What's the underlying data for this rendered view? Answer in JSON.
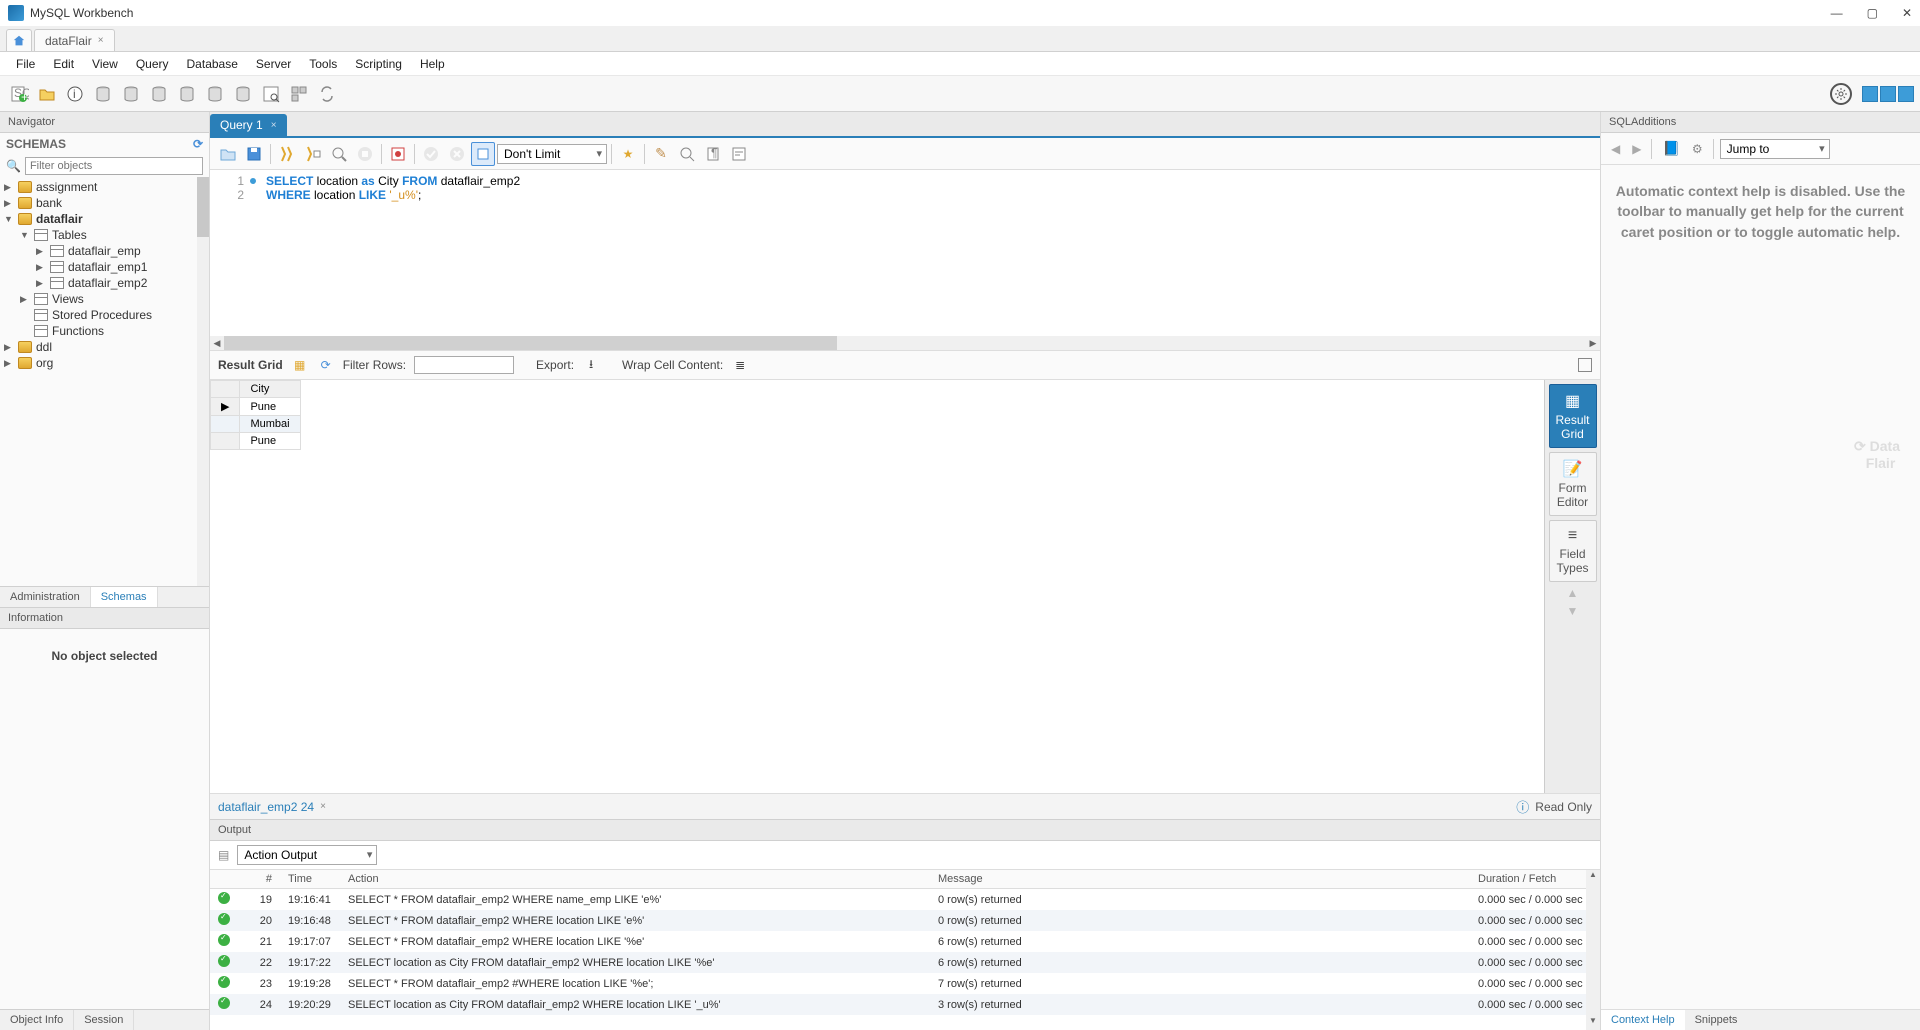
{
  "app": {
    "title": "MySQL Workbench"
  },
  "connTab": {
    "name": "dataFlair"
  },
  "menu": [
    "File",
    "Edit",
    "View",
    "Query",
    "Database",
    "Server",
    "Tools",
    "Scripting",
    "Help"
  ],
  "nav": {
    "panelTitle": "Navigator",
    "schemasLabel": "SCHEMAS",
    "filterPlaceholder": "Filter objects",
    "tree": {
      "n0": "assignment",
      "n1": "bank",
      "n2": "dataflair",
      "n2_tables": "Tables",
      "n2_t0": "dataflair_emp",
      "n2_t1": "dataflair_emp1",
      "n2_t2": "dataflair_emp2",
      "n2_views": "Views",
      "n2_sp": "Stored Procedures",
      "n2_fn": "Functions",
      "n3": "ddl",
      "n4": "org"
    },
    "bottomTabs": {
      "admin": "Administration",
      "schemas": "Schemas"
    },
    "infoTitle": "Information",
    "infoBody": "No object selected",
    "footTabs": {
      "objInfo": "Object Info",
      "session": "Session"
    }
  },
  "query": {
    "tabLabel": "Query 1",
    "limit": "Don't Limit",
    "line1": {
      "kw1": "SELECT",
      "t1": " location ",
      "kw2": "as",
      "t2": " City ",
      "kw3": "FROM",
      "t3": " dataflair_emp2"
    },
    "line2": {
      "kw1": "WHERE",
      "t1": " location ",
      "kw2": "LIKE",
      "str": "'_u%'",
      "t2": ";"
    }
  },
  "resultBar": {
    "label": "Result Grid",
    "filterLabel": "Filter Rows:",
    "export": "Export:",
    "wrap": "Wrap Cell Content:"
  },
  "grid": {
    "header": "City",
    "rows": [
      "Pune",
      "Mumbai",
      "Pune"
    ]
  },
  "sideTabs": {
    "t0": "Result Grid",
    "t1": "Form Editor",
    "t2": "Field Types"
  },
  "resultFoot": {
    "tabLabel": "dataflair_emp2 24",
    "readOnly": "Read Only"
  },
  "sqa": {
    "title": "SQLAdditions",
    "jump": "Jump to",
    "help": "Automatic context help is disabled. Use the toolbar to manually get help for the current caret position or to toggle automatic help.",
    "tabs": {
      "ctx": "Context Help",
      "snip": "Snippets"
    }
  },
  "output": {
    "title": "Output",
    "selector": "Action Output",
    "cols": {
      "num": "#",
      "time": "Time",
      "action": "Action",
      "msg": "Message",
      "dur": "Duration / Fetch"
    },
    "rows": [
      {
        "n": "19",
        "t": "19:16:41",
        "a": "SELECT * FROM dataflair_emp2 WHERE name_emp LIKE 'e%'",
        "m": "0 row(s) returned",
        "d": "0.000 sec / 0.000 sec"
      },
      {
        "n": "20",
        "t": "19:16:48",
        "a": "SELECT * FROM dataflair_emp2 WHERE location LIKE 'e%'",
        "m": "0 row(s) returned",
        "d": "0.000 sec / 0.000 sec"
      },
      {
        "n": "21",
        "t": "19:17:07",
        "a": "SELECT * FROM dataflair_emp2 WHERE location LIKE '%e'",
        "m": "6 row(s) returned",
        "d": "0.000 sec / 0.000 sec"
      },
      {
        "n": "22",
        "t": "19:17:22",
        "a": "SELECT location as City FROM dataflair_emp2 WHERE location LIKE '%e'",
        "m": "6 row(s) returned",
        "d": "0.000 sec / 0.000 sec"
      },
      {
        "n": "23",
        "t": "19:19:28",
        "a": "SELECT * FROM dataflair_emp2 #WHERE location LIKE '%e';",
        "m": "7 row(s) returned",
        "d": "0.000 sec / 0.000 sec"
      },
      {
        "n": "24",
        "t": "19:20:29",
        "a": "SELECT location as City FROM dataflair_emp2 WHERE location LIKE '_u%'",
        "m": "3 row(s) returned",
        "d": "0.000 sec / 0.000 sec"
      }
    ]
  }
}
